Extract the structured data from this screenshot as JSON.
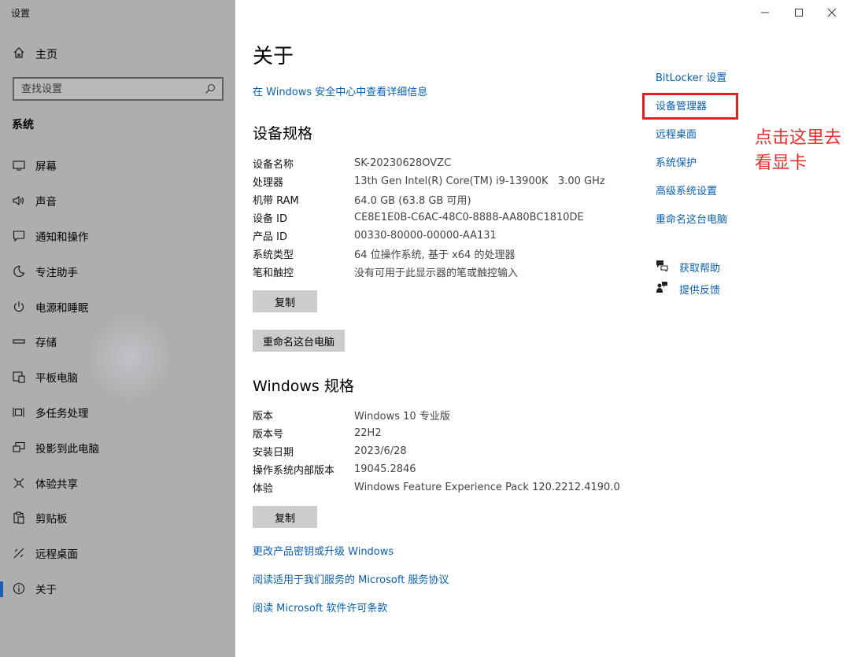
{
  "app": {
    "title": "设置",
    "window_controls": [
      "minimize-icon",
      "maximize-icon",
      "close-icon"
    ]
  },
  "sidebar": {
    "home_label": "主页",
    "search_placeholder": "查找设置",
    "section_title": "系统",
    "items": [
      {
        "label": "屏幕",
        "icon": "display-icon"
      },
      {
        "label": "声音",
        "icon": "speaker-icon"
      },
      {
        "label": "通知和操作",
        "icon": "notification-icon"
      },
      {
        "label": "专注助手",
        "icon": "moon-icon"
      },
      {
        "label": "电源和睡眠",
        "icon": "power-icon"
      },
      {
        "label": "存储",
        "icon": "storage-icon"
      },
      {
        "label": "平板电脑",
        "icon": "tablet-icon"
      },
      {
        "label": "多任务处理",
        "icon": "multitask-icon"
      },
      {
        "label": "投影到此电脑",
        "icon": "project-icon"
      },
      {
        "label": "体验共享",
        "icon": "share-icon"
      },
      {
        "label": "剪贴板",
        "icon": "clipboard-icon"
      },
      {
        "label": "远程桌面",
        "icon": "remote-icon"
      },
      {
        "label": "关于",
        "icon": "info-icon",
        "active": true
      }
    ]
  },
  "main": {
    "title": "关于",
    "security_link": "在 Windows 安全中心中查看详细信息",
    "device_specs": {
      "heading": "设备规格",
      "rows": [
        {
          "key": "设备名称",
          "value": "SK-20230628OVZC"
        },
        {
          "key": "处理器",
          "value": "13th Gen Intel(R) Core(TM) i9-13900K   3.00 GHz"
        },
        {
          "key": "机带 RAM",
          "value": "64.0 GB (63.8 GB 可用)"
        },
        {
          "key": "设备 ID",
          "value": "CE8E1E0B-C6AC-48C0-8888-AA80BC1810DE"
        },
        {
          "key": "产品 ID",
          "value": "00330-80000-00000-AA131"
        },
        {
          "key": "系统类型",
          "value": "64 位操作系统, 基于 x64 的处理器"
        },
        {
          "key": "笔和触控",
          "value": "没有可用于此显示器的笔或触控输入"
        }
      ],
      "copy_label": "复制",
      "rename_label": "重命名这台电脑"
    },
    "windows_specs": {
      "heading": "Windows 规格",
      "rows": [
        {
          "key": "版本",
          "value": "Windows 10 专业版"
        },
        {
          "key": "版本号",
          "value": "22H2"
        },
        {
          "key": "安装日期",
          "value": "2023/6/28"
        },
        {
          "key": "操作系统内部版本",
          "value": "19045.2846"
        },
        {
          "key": "体验",
          "value": "Windows Feature Experience Pack 120.2212.4190.0"
        }
      ],
      "copy_label": "复制"
    },
    "bottom_links": [
      "更改产品密钥或升级 Windows",
      "阅读适用于我们服务的 Microsoft 服务协议",
      "阅读 Microsoft 软件许可条款"
    ]
  },
  "related": {
    "links": [
      "BitLocker 设置",
      "设备管理器",
      "远程桌面",
      "系统保护",
      "高级系统设置",
      "重命名这台电脑"
    ],
    "help": [
      {
        "label": "获取帮助",
        "icon": "help-chat-icon"
      },
      {
        "label": "提供反馈",
        "icon": "feedback-icon"
      }
    ]
  },
  "annotation": {
    "text": "点击这里去看显卡",
    "color": "#e02020"
  },
  "colors": {
    "sidebar_bg": "#aeaeae",
    "link": "#0a5fb0",
    "accent": "#1a5fb4",
    "button_bg": "#cccccc"
  }
}
